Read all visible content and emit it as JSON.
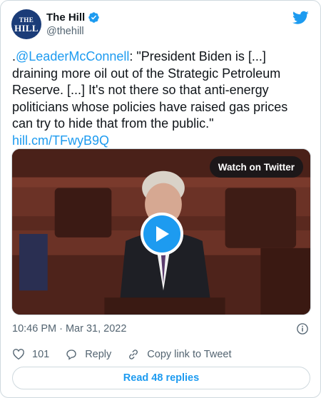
{
  "account": {
    "name": "The Hill",
    "handle": "@thehill",
    "avatar_line1": "THE",
    "avatar_line2": "HILL"
  },
  "tweet": {
    "prefix": ".",
    "mention": "@LeaderMcConnell",
    "text": ": \"President Biden is [...] draining more oil out of the Strategic Petroleum Reserve. [...] It's not there so that anti-energy politicians whose policies have raised gas prices can try to hide that from the public.\"",
    "link": "hill.cm/TFwyB9Q"
  },
  "media": {
    "watch_label": "Watch on Twitter"
  },
  "meta": {
    "timestamp": "10:46 PM · Mar 31, 2022"
  },
  "actions": {
    "likes": "101",
    "reply_label": "Reply",
    "copy_label": "Copy link to Tweet"
  },
  "replies_button": "Read 48 replies",
  "colors": {
    "accent": "#1d9bf0",
    "text": "#0f1419",
    "muted": "#536471",
    "border": "#cfd9de"
  },
  "icons": [
    "verified-badge-icon",
    "twitter-bird-icon",
    "play-icon",
    "info-icon",
    "heart-icon",
    "reply-bubble-icon",
    "link-icon"
  ]
}
